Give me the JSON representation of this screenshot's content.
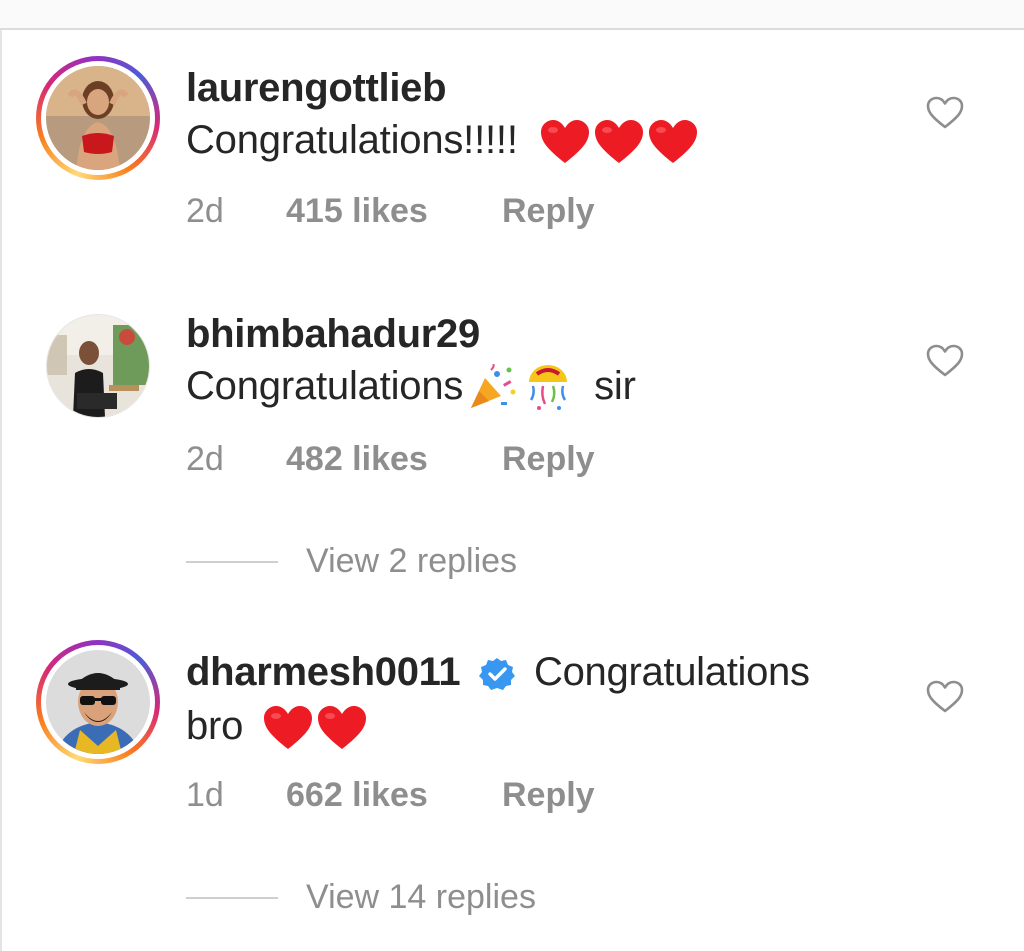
{
  "comments": [
    {
      "username": "laurengottlieb",
      "text": "Congratulations!!!!!",
      "emoji": [
        "red-heart",
        "red-heart",
        "red-heart"
      ],
      "time": "2d",
      "likes": "415 likes",
      "reply_label": "Reply",
      "has_story_ring": true
    },
    {
      "username": "bhimbahadur29",
      "text_before": "Congratulations",
      "emoji": [
        "party-popper",
        "confetti-ball"
      ],
      "text_after": "sir",
      "time": "2d",
      "likes": "482 likes",
      "reply_label": "Reply",
      "view_replies": "View 2 replies",
      "has_story_ring": false
    },
    {
      "username": "dharmesh0011",
      "verified": true,
      "text_line1": "Congratulations",
      "text_line2": "bro",
      "emoji": [
        "red-heart",
        "red-heart"
      ],
      "time": "1d",
      "likes": "662 likes",
      "reply_label": "Reply",
      "view_replies": "View 14 replies",
      "has_story_ring": true
    }
  ],
  "colors": {
    "text": "#262626",
    "secondary": "#8e8e8e",
    "heart": "#ed1c24",
    "verified": "#3897f0"
  }
}
